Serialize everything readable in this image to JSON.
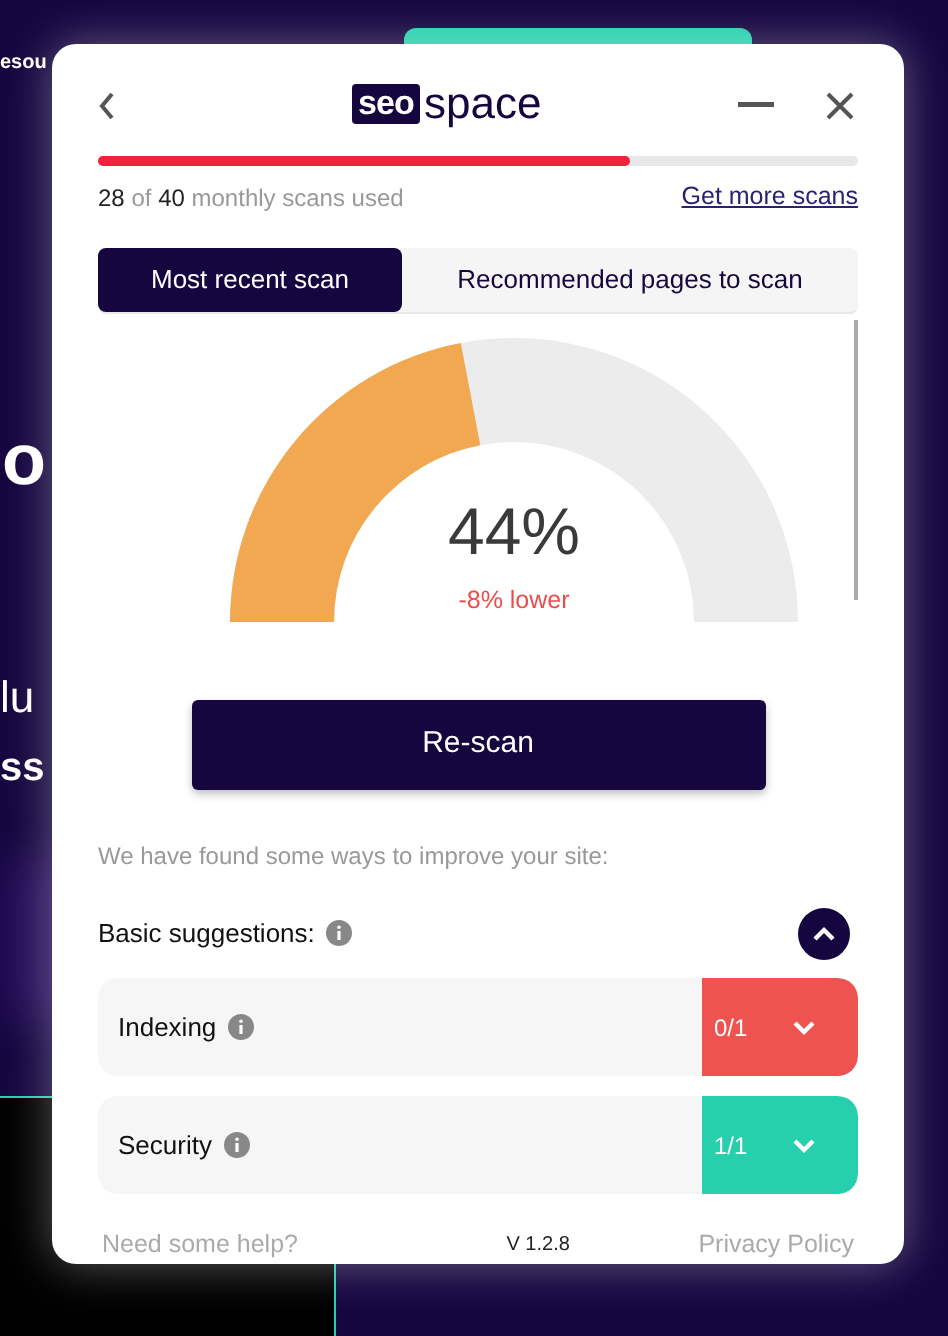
{
  "background": {
    "texts": [
      "esou",
      "o",
      "lu",
      "ss"
    ]
  },
  "header": {
    "logo_box": "seo",
    "logo_text": "space"
  },
  "usage": {
    "level": 0.7,
    "used": "28",
    "of": "of",
    "total": "40",
    "label": "monthly scans used",
    "link": "Get more scans"
  },
  "tabs": [
    {
      "label": "Most recent scan",
      "selected": true
    },
    {
      "label": "Recommended pages to scan",
      "selected": false
    }
  ],
  "score": {
    "level": 0.44,
    "value": "44%",
    "change": "-8% lower"
  },
  "rescan_button": "Re-scan",
  "intro": "We have found some ways to improve your site:",
  "suggestions": {
    "title": "Basic suggestions:",
    "expanded": true,
    "items": [
      {
        "label": "Indexing",
        "count": "0/1",
        "color": "#ef5350"
      },
      {
        "label": "Security",
        "count": "1/1",
        "color": "#26d0ac"
      }
    ]
  },
  "footer": {
    "help": "Need some help?",
    "version": "V 1.2.8",
    "privacy": "Privacy Policy"
  }
}
